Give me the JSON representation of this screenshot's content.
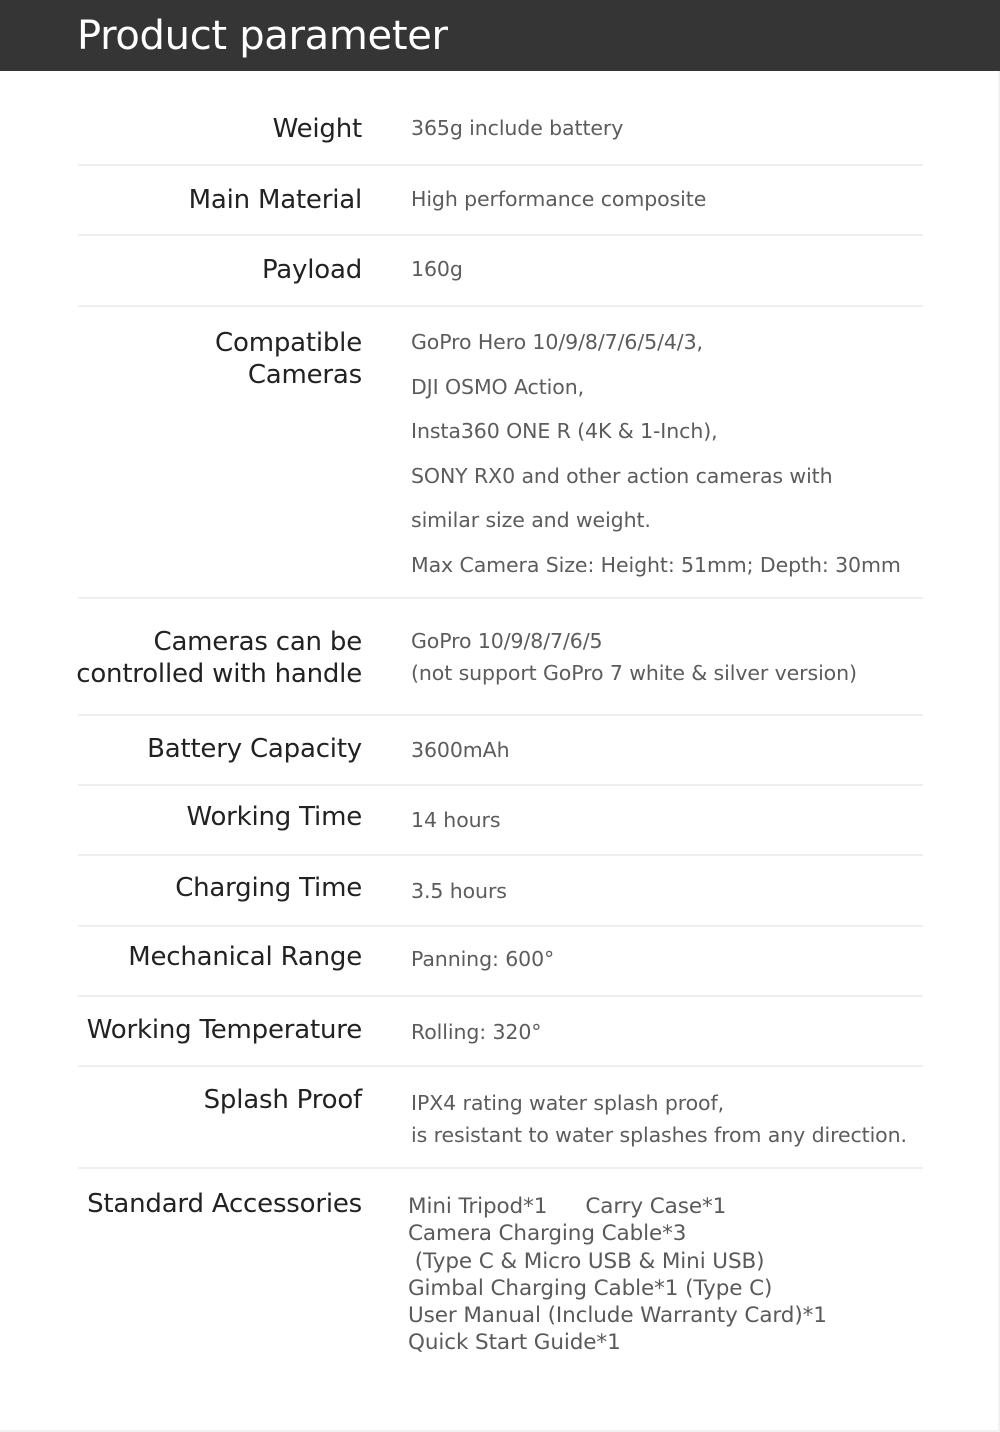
{
  "header": {
    "title": "Product parameter"
  },
  "params": [
    {
      "label": [
        "Weight"
      ],
      "value": [
        "365g include battery"
      ]
    },
    {
      "label": [
        "Main Material"
      ],
      "value": [
        "High performance composite"
      ]
    },
    {
      "label": [
        "Payload"
      ],
      "value": [
        "160g"
      ]
    },
    {
      "label": [
        "Compatible",
        "Cameras"
      ],
      "value": [
        "GoPro Hero 10/9/8/7/6/5/4/3,",
        "DJI OSMO Action,",
        "Insta360 ONE R (4K & 1-Inch),",
        "SONY RX0 and other action cameras with",
        "similar size and weight.",
        "Max Camera Size: Height: 51mm; Depth: 30mm"
      ]
    },
    {
      "label": [
        "Cameras can be",
        "controlled with handle"
      ],
      "value": [
        "GoPro 10/9/8/7/6/5",
        "(not support GoPro 7 white & silver version)"
      ]
    },
    {
      "label": [
        "Battery Capacity"
      ],
      "value": [
        "3600mAh"
      ]
    },
    {
      "label": [
        "Working Time"
      ],
      "value": [
        "14 hours"
      ]
    },
    {
      "label": [
        "Charging Time"
      ],
      "value": [
        "3.5 hours"
      ]
    },
    {
      "label": [
        "Mechanical Range"
      ],
      "value": [
        "Panning: 600°"
      ]
    },
    {
      "label": [
        "Working Temperature"
      ],
      "value": [
        "Rolling: 320°"
      ]
    },
    {
      "label": [
        "Splash Proof"
      ],
      "value": [
        "IPX4 rating water splash proof,",
        "is resistant to water splashes from any direction."
      ]
    },
    {
      "label": [
        "Standard Accessories"
      ],
      "value": []
    }
  ],
  "accessories": {
    "first_line": [
      "Mini Tripod*1",
      "Carry Case*1"
    ],
    "lines": [
      "Camera Charging Cable*3",
      " (Type C & Micro USB & Mini USB)",
      "Gimbal Charging Cable*1 (Type C)",
      "User Manual (Include Warranty Card)*1",
      "Quick Start Guide*1"
    ]
  }
}
